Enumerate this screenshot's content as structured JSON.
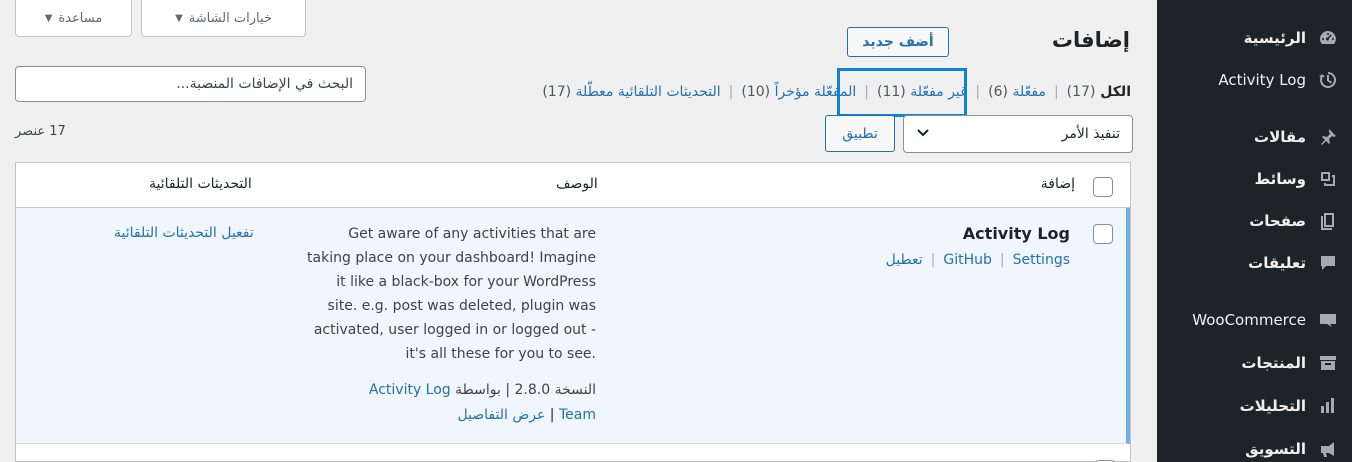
{
  "sidebar": {
    "items": [
      {
        "label": "الرئيسية",
        "icon": "dashboard-icon"
      },
      {
        "label": "Activity Log",
        "icon": "history-icon"
      },
      {
        "label": "مقالات",
        "icon": "pin-icon"
      },
      {
        "label": "وسائط",
        "icon": "media-icon"
      },
      {
        "label": "صفحات",
        "icon": "pages-icon"
      },
      {
        "label": "تعليقات",
        "icon": "comments-icon"
      },
      {
        "label": "WooCommerce",
        "icon": "woo-icon"
      },
      {
        "label": "المنتجات",
        "icon": "archive-icon"
      },
      {
        "label": "التحليلات",
        "icon": "chart-icon"
      },
      {
        "label": "التسويق",
        "icon": "megaphone-icon"
      }
    ]
  },
  "screen_meta": {
    "screen_options": "خيارات الشاشة",
    "help": "مساعدة"
  },
  "header": {
    "title": "إضافات",
    "add_new": "أضف جديد"
  },
  "search": {
    "placeholder": "البحث في الإضافات المنصبة..."
  },
  "filters": [
    {
      "label": "الكل",
      "count": "(17)",
      "current": true
    },
    {
      "label": "مفعّلة",
      "count": "(6)"
    },
    {
      "label": "غير مفعّلة",
      "count": "(11)"
    },
    {
      "label": "المفعّلة مؤخراً",
      "count": "(10)"
    },
    {
      "label": "التحديثات التلقائية معطّلة",
      "count": "(17)"
    }
  ],
  "bulk": {
    "selected": "تنفيذ الأمر",
    "apply": "تطبيق",
    "items_count": "17 عنصر"
  },
  "table": {
    "columns": {
      "plugin": "إضافة",
      "description": "الوصف",
      "auto_updates": "التحديثات التلقائية"
    },
    "rows": [
      {
        "name": "Activity Log",
        "actions": [
          "Settings",
          "GitHub",
          "تعطيل"
        ],
        "description": "Get aware of any activities that are taking place on your dashboard! Imagine it like a black-box for your WordPress site. e.g. post was deleted, plugin was activated, user logged in or logged out - it's all these for you to see.",
        "version_text": "النسخة 2.8.0 | بواسطة",
        "author": "Activity Log",
        "author_team": "Team",
        "view_details": "عرض التفاصيل",
        "auto_update": "تفعيل التحديثات التلقائية"
      }
    ]
  },
  "colors": {
    "sidebar_bg": "#1d2327",
    "accent": "#2271b1",
    "highlight_box": "#0a84d8",
    "row_bg": "#f0f6fc"
  }
}
